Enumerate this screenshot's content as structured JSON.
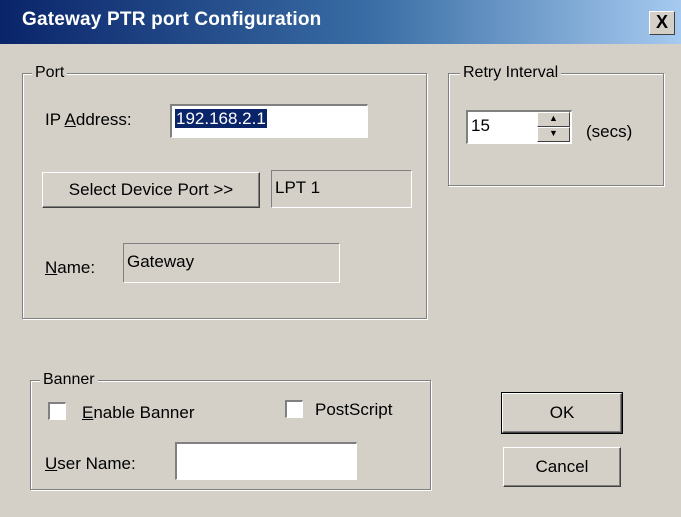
{
  "window": {
    "title": "Gateway PTR port Configuration",
    "close_glyph": "X"
  },
  "port_group": {
    "legend": "Port",
    "ip_label_pre": "IP ",
    "ip_label_mnemonic": "A",
    "ip_label_post": "ddress:",
    "ip_value": "192.168.2.1",
    "select_device_button": "Select Device Port >>",
    "device_port_value": "LPT 1",
    "name_label_mnemonic": "N",
    "name_label_post": "ame:",
    "name_value": "Gateway"
  },
  "retry_group": {
    "legend": "Retry Interval",
    "value": "15",
    "unit": "(secs)",
    "up_glyph": "▲",
    "down_glyph": "▼"
  },
  "banner_group": {
    "legend": "Banner",
    "enable_banner_mnemonic": "E",
    "enable_banner_post": "nable Banner",
    "enable_banner_checked": false,
    "postscript_label": "PostScript",
    "postscript_checked": false,
    "user_name_mnemonic": "U",
    "user_name_post": "ser Name:",
    "user_name_value": ""
  },
  "buttons": {
    "ok": "OK",
    "cancel": "Cancel"
  }
}
